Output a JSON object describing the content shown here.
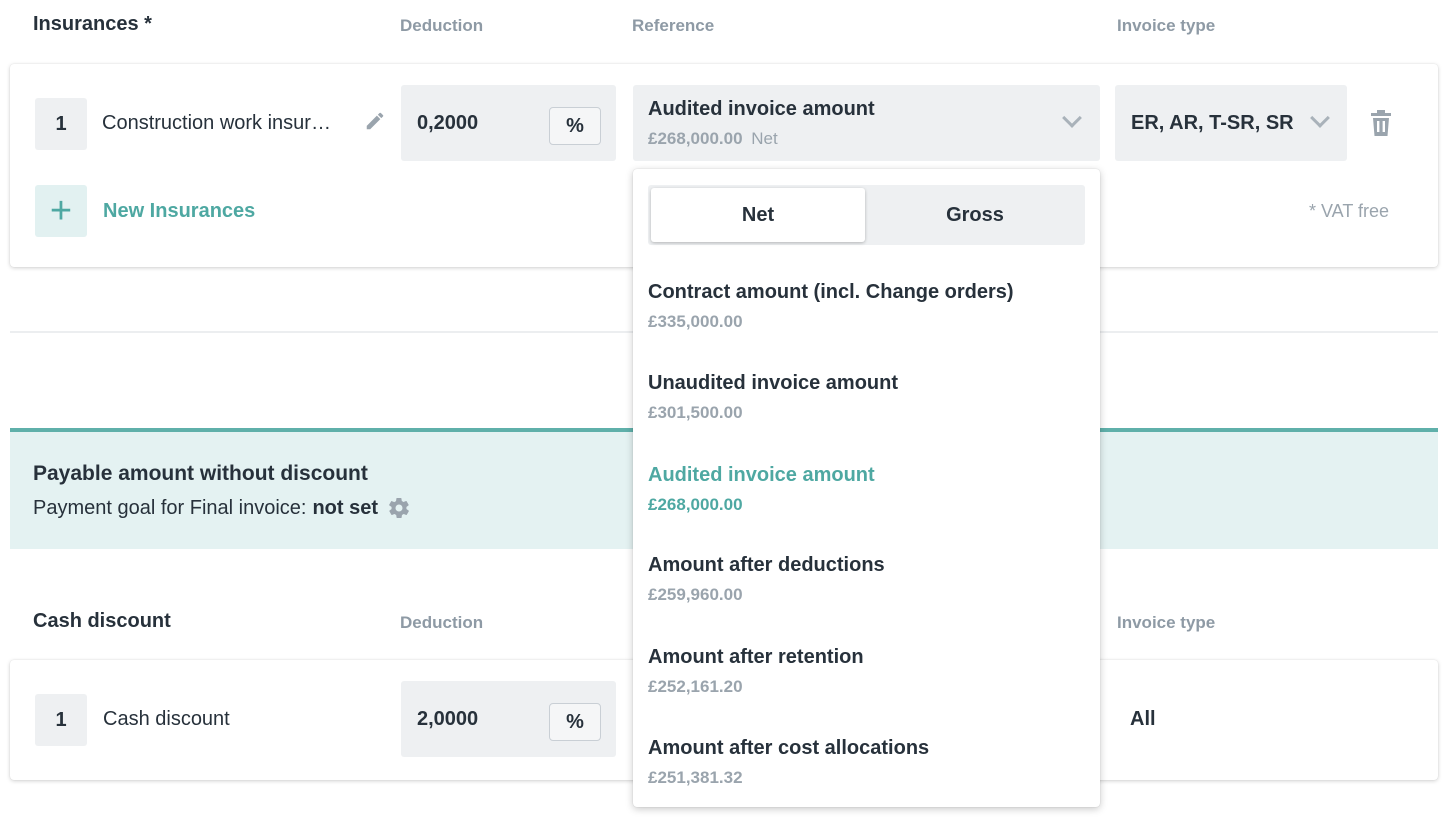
{
  "insurances": {
    "title": "Insurances *",
    "headers": {
      "deduction": "Deduction",
      "reference": "Reference",
      "invoice_type": "Invoice type"
    },
    "row": {
      "index": "1",
      "name": "Construction work insur…",
      "deduction_value": "0,2000",
      "deduction_unit": "%",
      "reference_label": "Audited invoice amount",
      "reference_amount": "£268,000.00",
      "reference_basis": "Net",
      "invoice_type": "ER, AR, T-SR, SR"
    },
    "new_label": "New Insurances",
    "footnote": "* VAT free"
  },
  "payable": {
    "title": "Payable amount without discount",
    "goal_prefix": "Payment goal for Final invoice:",
    "goal_value": "not set"
  },
  "cash_discount": {
    "title": "Cash discount",
    "headers": {
      "deduction": "Deduction",
      "invoice_type": "Invoice type"
    },
    "row": {
      "index": "1",
      "name": "Cash discount",
      "deduction_value": "2,0000",
      "deduction_unit": "%",
      "invoice_type": "All"
    }
  },
  "dropdown": {
    "toggle": {
      "net": "Net",
      "gross": "Gross",
      "active": "Net"
    },
    "options": [
      {
        "label": "Contract amount (incl. Change orders)",
        "amount": "£335,000.00"
      },
      {
        "label": "Unaudited invoice amount",
        "amount": "£301,500.00"
      },
      {
        "label": "Audited invoice amount",
        "amount": "£268,000.00",
        "selected": true
      },
      {
        "label": "Amount after deductions",
        "amount": "£259,960.00"
      },
      {
        "label": "Amount after retention",
        "amount": "£252,161.20"
      },
      {
        "label": "Amount after cost allocations",
        "amount": "£251,381.32"
      }
    ]
  },
  "icons": {
    "edit": "pencil-icon",
    "delete": "trash-icon",
    "add": "plus-icon",
    "settings": "gear-icon",
    "expand": "chevron-down-icon"
  },
  "colors": {
    "accent": "#4ea8a2",
    "accent_border": "#5fb0aa",
    "accent_bg": "#e4f2f2",
    "field_bg": "#eef0f2",
    "text": "#27313b",
    "muted": "#9aa4ad"
  }
}
